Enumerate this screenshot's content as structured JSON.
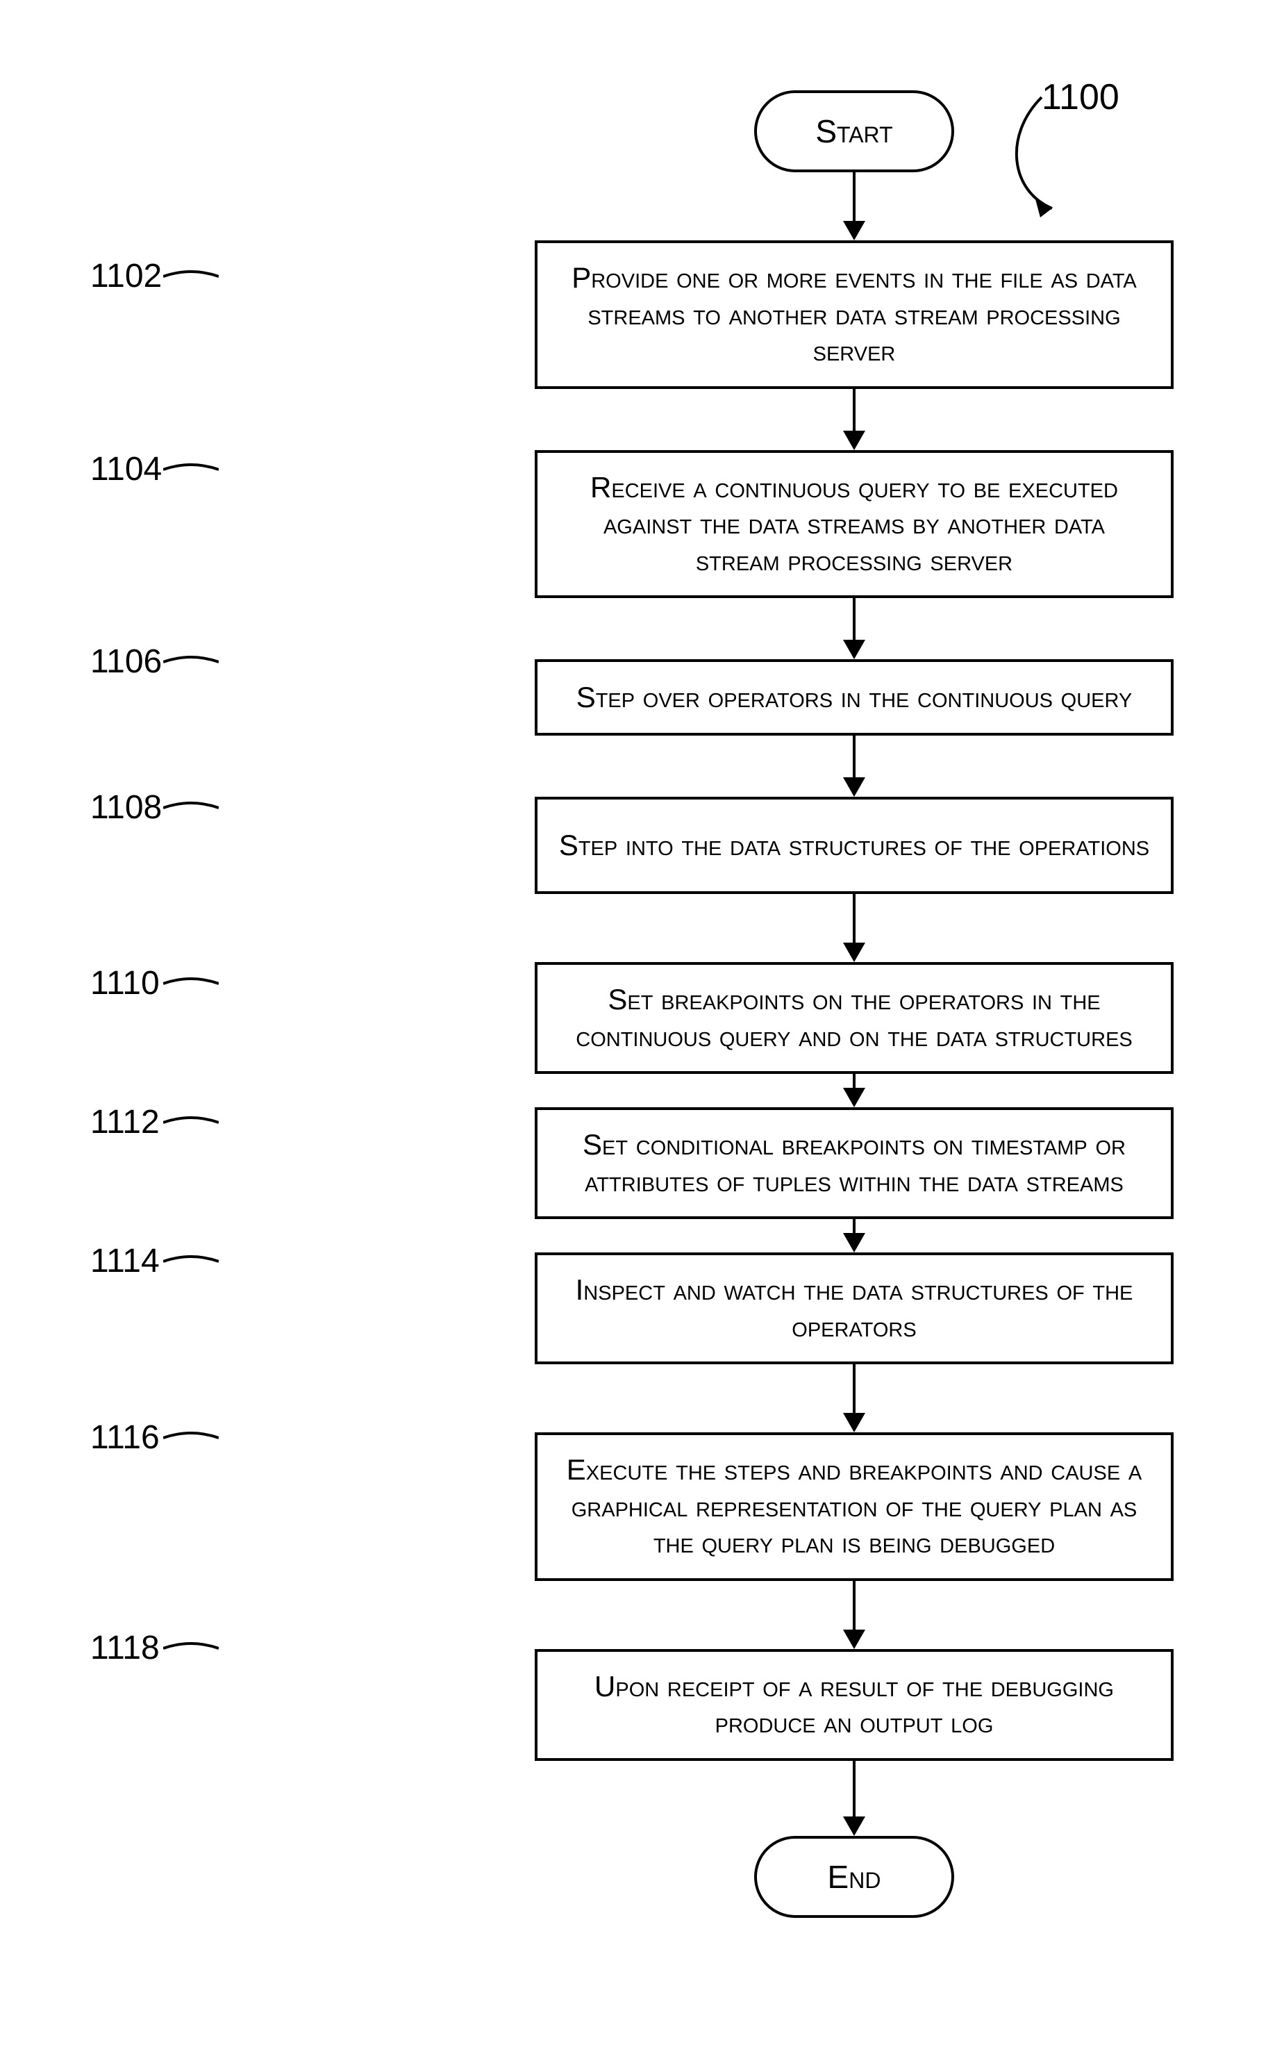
{
  "figure_label": "1100",
  "terminators": {
    "start": "Start",
    "end": "End"
  },
  "steps": [
    {
      "ref": "1102",
      "text": "Provide one or more events in the file as data streams to another data stream processing server"
    },
    {
      "ref": "1104",
      "text": "Receive a continuous query to be executed against the data streams by another data stream processing server"
    },
    {
      "ref": "1106",
      "text": "Step over operators in the continuous query"
    },
    {
      "ref": "1108",
      "text": "Step into the data structures of the operations"
    },
    {
      "ref": "1110",
      "text": "Set breakpoints on the operators in the continuous query and on the data structures"
    },
    {
      "ref": "1112",
      "text": "Set conditional breakpoints on timestamp or attributes of tuples within the data streams"
    },
    {
      "ref": "1114",
      "text": "Inspect and watch the data structures of the operators"
    },
    {
      "ref": "1116",
      "text": "Execute the steps and breakpoints and cause a graphical representation of the query plan as the query plan is being debugged"
    },
    {
      "ref": "1118",
      "text": "Upon receipt of a result of the debugging produce an output log"
    }
  ],
  "chart_data": {
    "type": "flowchart",
    "title": "",
    "nodes": [
      {
        "id": "start",
        "kind": "terminator",
        "label": "Start"
      },
      {
        "id": "1102",
        "kind": "process",
        "label": "Provide one or more events in the file as data streams to another data stream processing server"
      },
      {
        "id": "1104",
        "kind": "process",
        "label": "Receive a continuous query to be executed against the data streams by another data stream processing server"
      },
      {
        "id": "1106",
        "kind": "process",
        "label": "Step over operators in the continuous query"
      },
      {
        "id": "1108",
        "kind": "process",
        "label": "Step into the data structures of the operations"
      },
      {
        "id": "1110",
        "kind": "process",
        "label": "Set breakpoints on the operators in the continuous query and on the data structures"
      },
      {
        "id": "1112",
        "kind": "process",
        "label": "Set conditional breakpoints on timestamp or attributes of tuples within the data streams"
      },
      {
        "id": "1114",
        "kind": "process",
        "label": "Inspect and watch the data structures of the operators"
      },
      {
        "id": "1116",
        "kind": "process",
        "label": "Execute the steps and breakpoints and cause a graphical representation of the query plan as the query plan is being debugged"
      },
      {
        "id": "1118",
        "kind": "process",
        "label": "Upon receipt of a result of the debugging produce an output log"
      },
      {
        "id": "end",
        "kind": "terminator",
        "label": "End"
      }
    ],
    "edges": [
      {
        "from": "start",
        "to": "1102"
      },
      {
        "from": "1102",
        "to": "1104"
      },
      {
        "from": "1104",
        "to": "1106"
      },
      {
        "from": "1106",
        "to": "1108"
      },
      {
        "from": "1108",
        "to": "1110"
      },
      {
        "from": "1110",
        "to": "1112"
      },
      {
        "from": "1112",
        "to": "1114"
      },
      {
        "from": "1114",
        "to": "1116"
      },
      {
        "from": "1116",
        "to": "1118"
      },
      {
        "from": "1118",
        "to": "end"
      }
    ],
    "figure_ref": "1100"
  }
}
